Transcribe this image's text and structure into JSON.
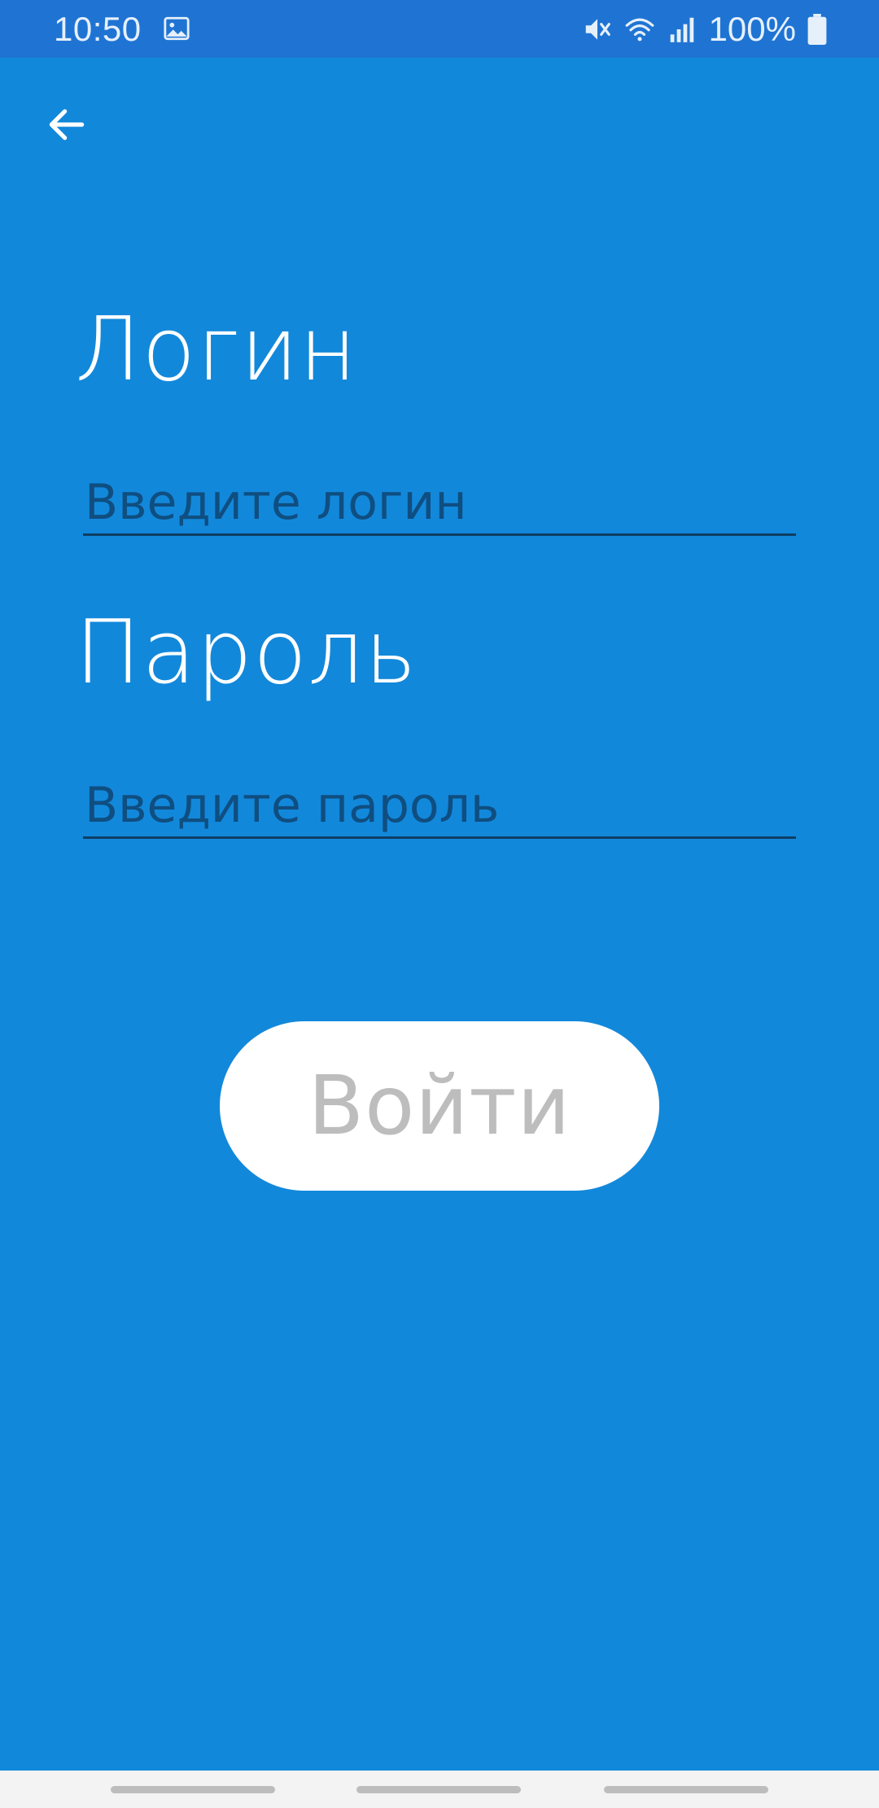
{
  "status_bar": {
    "time": "10:50",
    "battery_percent": "100%",
    "icons": [
      "gallery-icon",
      "mute-icon",
      "wifi-icon",
      "signal-icon",
      "battery-icon"
    ],
    "background_color": "#1F74D3"
  },
  "header": {
    "back_icon": "arrow-left-icon"
  },
  "form": {
    "login_label": "Логин",
    "login_placeholder": "Введите логин",
    "login_value": "",
    "password_label": "Пароль",
    "password_placeholder": "Введите пароль",
    "password_value": "",
    "submit_label": "Войти"
  },
  "colors": {
    "background": "#1288DB",
    "label_text": "#FFFFFF",
    "input_underline": "#0F3E63",
    "button_background": "#FFFFFF",
    "button_text": "#BDBDBD"
  }
}
